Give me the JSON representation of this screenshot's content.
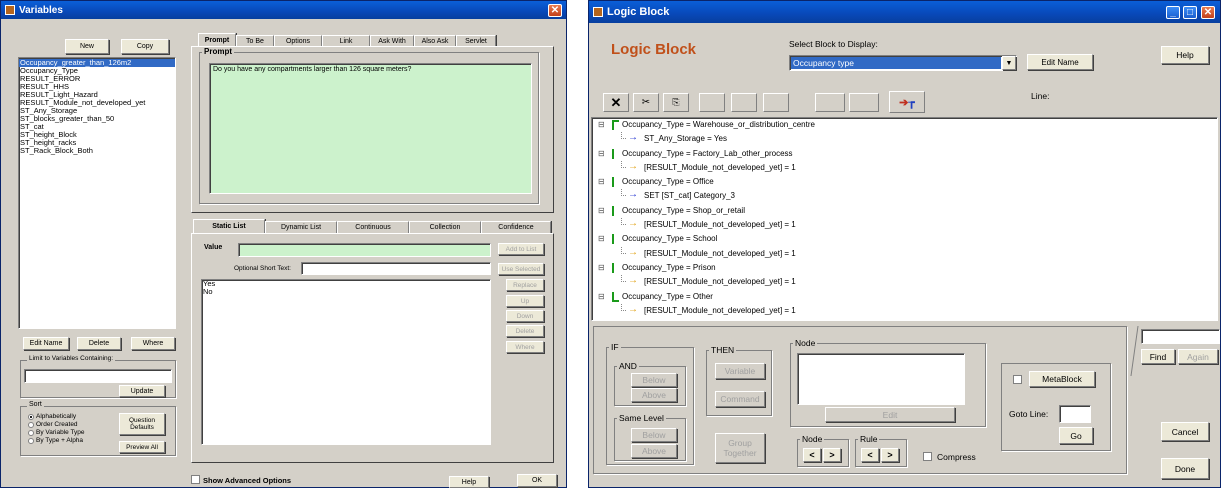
{
  "variables_window": {
    "title": "Variables",
    "new_label": "New",
    "copy_label": "Copy",
    "variables": [
      "Occupancy_greater_than_126m2",
      "Occupancy_Type",
      "RESULT_ERROR",
      "RESULT_HHS",
      "RESULT_Light_Hazard",
      "RESULT_Module_not_developed_yet",
      "ST_Any_Storage",
      "ST_blocks_greater_than_50",
      "ST_cat",
      "ST_height_Block",
      "ST_height_racks",
      "ST_Rack_Block_Both"
    ],
    "edit_name_label": "Edit Name",
    "delete_label": "Delete",
    "where_label": "Where",
    "limit_label": "Limit to Variables Containing:",
    "limit_value": "",
    "update_label": "Update",
    "sort_label": "Sort",
    "sort_options": [
      "Alphabetically",
      "Order Created",
      "By Variable Type",
      "By Type + Alpha"
    ],
    "question_defaults_label": "Question Defaults",
    "preview_all_label": "Preview All",
    "tabs": [
      "Prompt",
      "To Be",
      "Options",
      "Link",
      "Ask With",
      "Also Ask",
      "Servlet"
    ],
    "prompt_group_label": "Prompt",
    "prompt_text": "Do you have any compartments larger than 126 square meters?",
    "lower_tabs": [
      "Static List",
      "Dynamic List",
      "Continuous",
      "Collection",
      "Confidence"
    ],
    "value_label": "Value",
    "value_text": "",
    "add_to_list_label": "Add to List",
    "optional_short_text_label": "Optional Short Text:",
    "use_selected_label": "Use Selected",
    "list_values": [
      "Yes",
      "No"
    ],
    "replace_label": "Replace",
    "up_label": "Up",
    "down_label": "Down",
    "delete_value_label": "Delete",
    "where_value_label": "Where",
    "show_advanced_label": "Show Advanced Options",
    "help_label": "Help",
    "ok_label": "OK"
  },
  "logic_window": {
    "title": "Logic Block",
    "heading": "Logic Block",
    "select_label": "Select Block to Display:",
    "selected_block": "Occupancy type",
    "edit_name_label": "Edit Name",
    "help_label": "Help",
    "line_label": "Line:",
    "tree": [
      {
        "text": "Occupancy_Type = Warehouse_or_distribution_centre",
        "level": 0,
        "marker": "green"
      },
      {
        "text": "ST_Any_Storage = Yes",
        "level": 1,
        "arrow": "blue"
      },
      {
        "text": "Occupancy_Type = Factory_Lab_other_process",
        "level": 0,
        "marker": "green"
      },
      {
        "text": "[RESULT_Module_not_developed_yet] = 1",
        "level": 1,
        "arrow": "orange"
      },
      {
        "text": "Occupancy_Type = Office",
        "level": 0,
        "marker": "green"
      },
      {
        "text": "SET  [ST_cat]  Category_3",
        "level": 1,
        "arrow": "blue"
      },
      {
        "text": "Occupancy_Type = Shop_or_retail",
        "level": 0,
        "marker": "green"
      },
      {
        "text": "[RESULT_Module_not_developed_yet] = 1",
        "level": 1,
        "arrow": "orange"
      },
      {
        "text": "Occupancy_Type = School",
        "level": 0,
        "marker": "green"
      },
      {
        "text": "[RESULT_Module_not_developed_yet] = 1",
        "level": 1,
        "arrow": "orange"
      },
      {
        "text": "Occupancy_Type = Prison",
        "level": 0,
        "marker": "green"
      },
      {
        "text": "[RESULT_Module_not_developed_yet] = 1",
        "level": 1,
        "arrow": "orange"
      },
      {
        "text": "Occupancy_Type = Other",
        "level": 0,
        "marker": "green"
      },
      {
        "text": "[RESULT_Module_not_developed_yet] = 1",
        "level": 1,
        "arrow": "orange"
      }
    ],
    "if_label": "IF",
    "and_label": "AND",
    "below_label": "Below",
    "above_label": "Above",
    "same_level_label": "Same Level",
    "then_label": "THEN",
    "variable_label": "Variable",
    "command_label": "Command",
    "group_together_label": "Group Together",
    "node_label": "Node",
    "edit_label": "Edit",
    "node_nav_label": "Node",
    "rule_nav_label": "Rule",
    "prev_symbol": "<",
    "next_symbol": ">",
    "compress_label": "Compress",
    "metablock_label": "MetaBlock",
    "goto_line_label": "Goto Line:",
    "go_label": "Go",
    "find_label": "Find",
    "again_label": "Again",
    "cancel_label": "Cancel",
    "done_label": "Done"
  }
}
